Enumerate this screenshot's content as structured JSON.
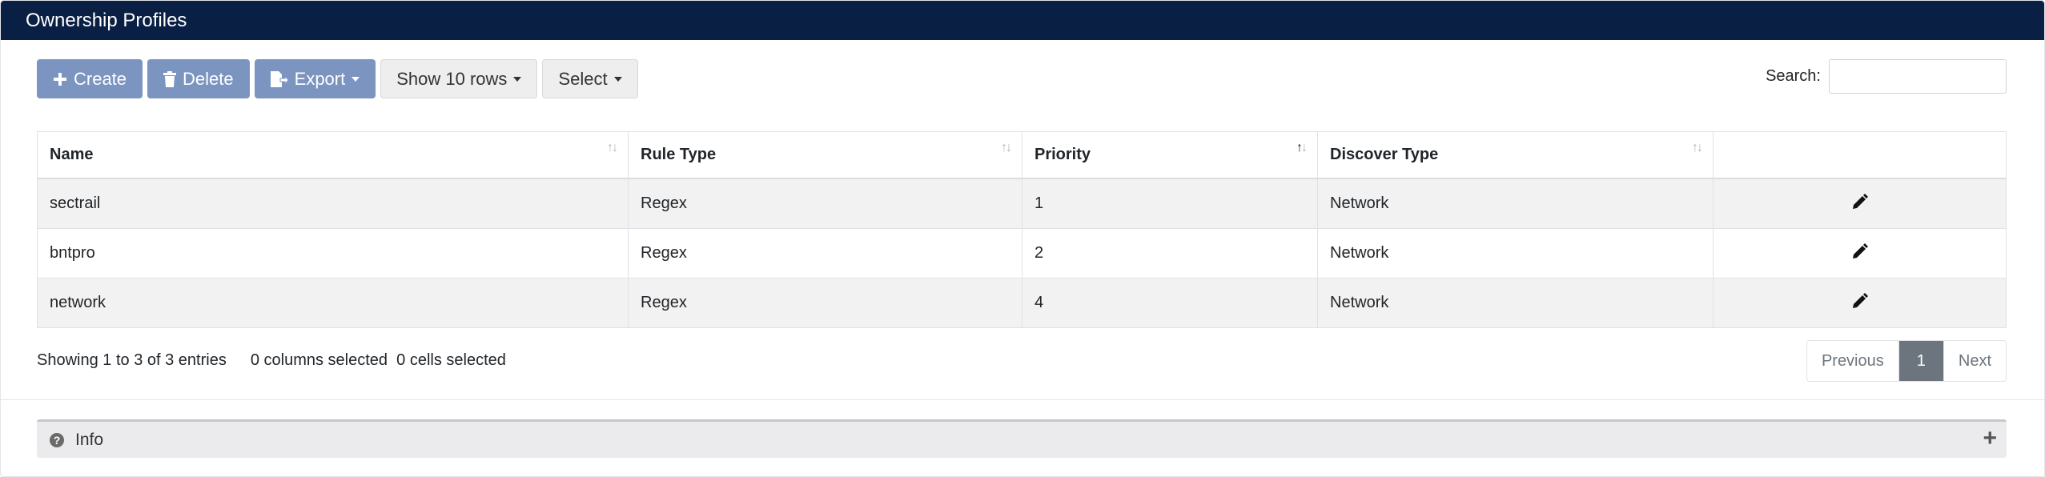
{
  "header": {
    "title": "Ownership Profiles"
  },
  "toolbar": {
    "create_label": "Create",
    "delete_label": "Delete",
    "export_label": "Export",
    "rows_label": "Show 10 rows",
    "select_label": "Select"
  },
  "search": {
    "label": "Search:",
    "value": ""
  },
  "table": {
    "columns": [
      "Name",
      "Rule Type",
      "Priority",
      "Discover Type",
      ""
    ],
    "sorted_column": "Priority",
    "sort_direction": "ascending",
    "rows": [
      {
        "name": "sectrail",
        "rule_type": "Regex",
        "priority": "1",
        "discover_type": "Network"
      },
      {
        "name": "bntpro",
        "rule_type": "Regex",
        "priority": "2",
        "discover_type": "Network"
      },
      {
        "name": "network",
        "rule_type": "Regex",
        "priority": "4",
        "discover_type": "Network"
      }
    ]
  },
  "footer": {
    "showing": "Showing 1 to 3 of 3 entries",
    "columns_selected": "0 columns selected",
    "cells_selected": "0 cells selected"
  },
  "pagination": {
    "previous": "Previous",
    "current": "1",
    "next": "Next"
  },
  "info": {
    "label": "Info"
  },
  "colors": {
    "header_bg": "#0a1f44",
    "primary_button": "#7b94c0",
    "active_page": "#6c757d"
  }
}
